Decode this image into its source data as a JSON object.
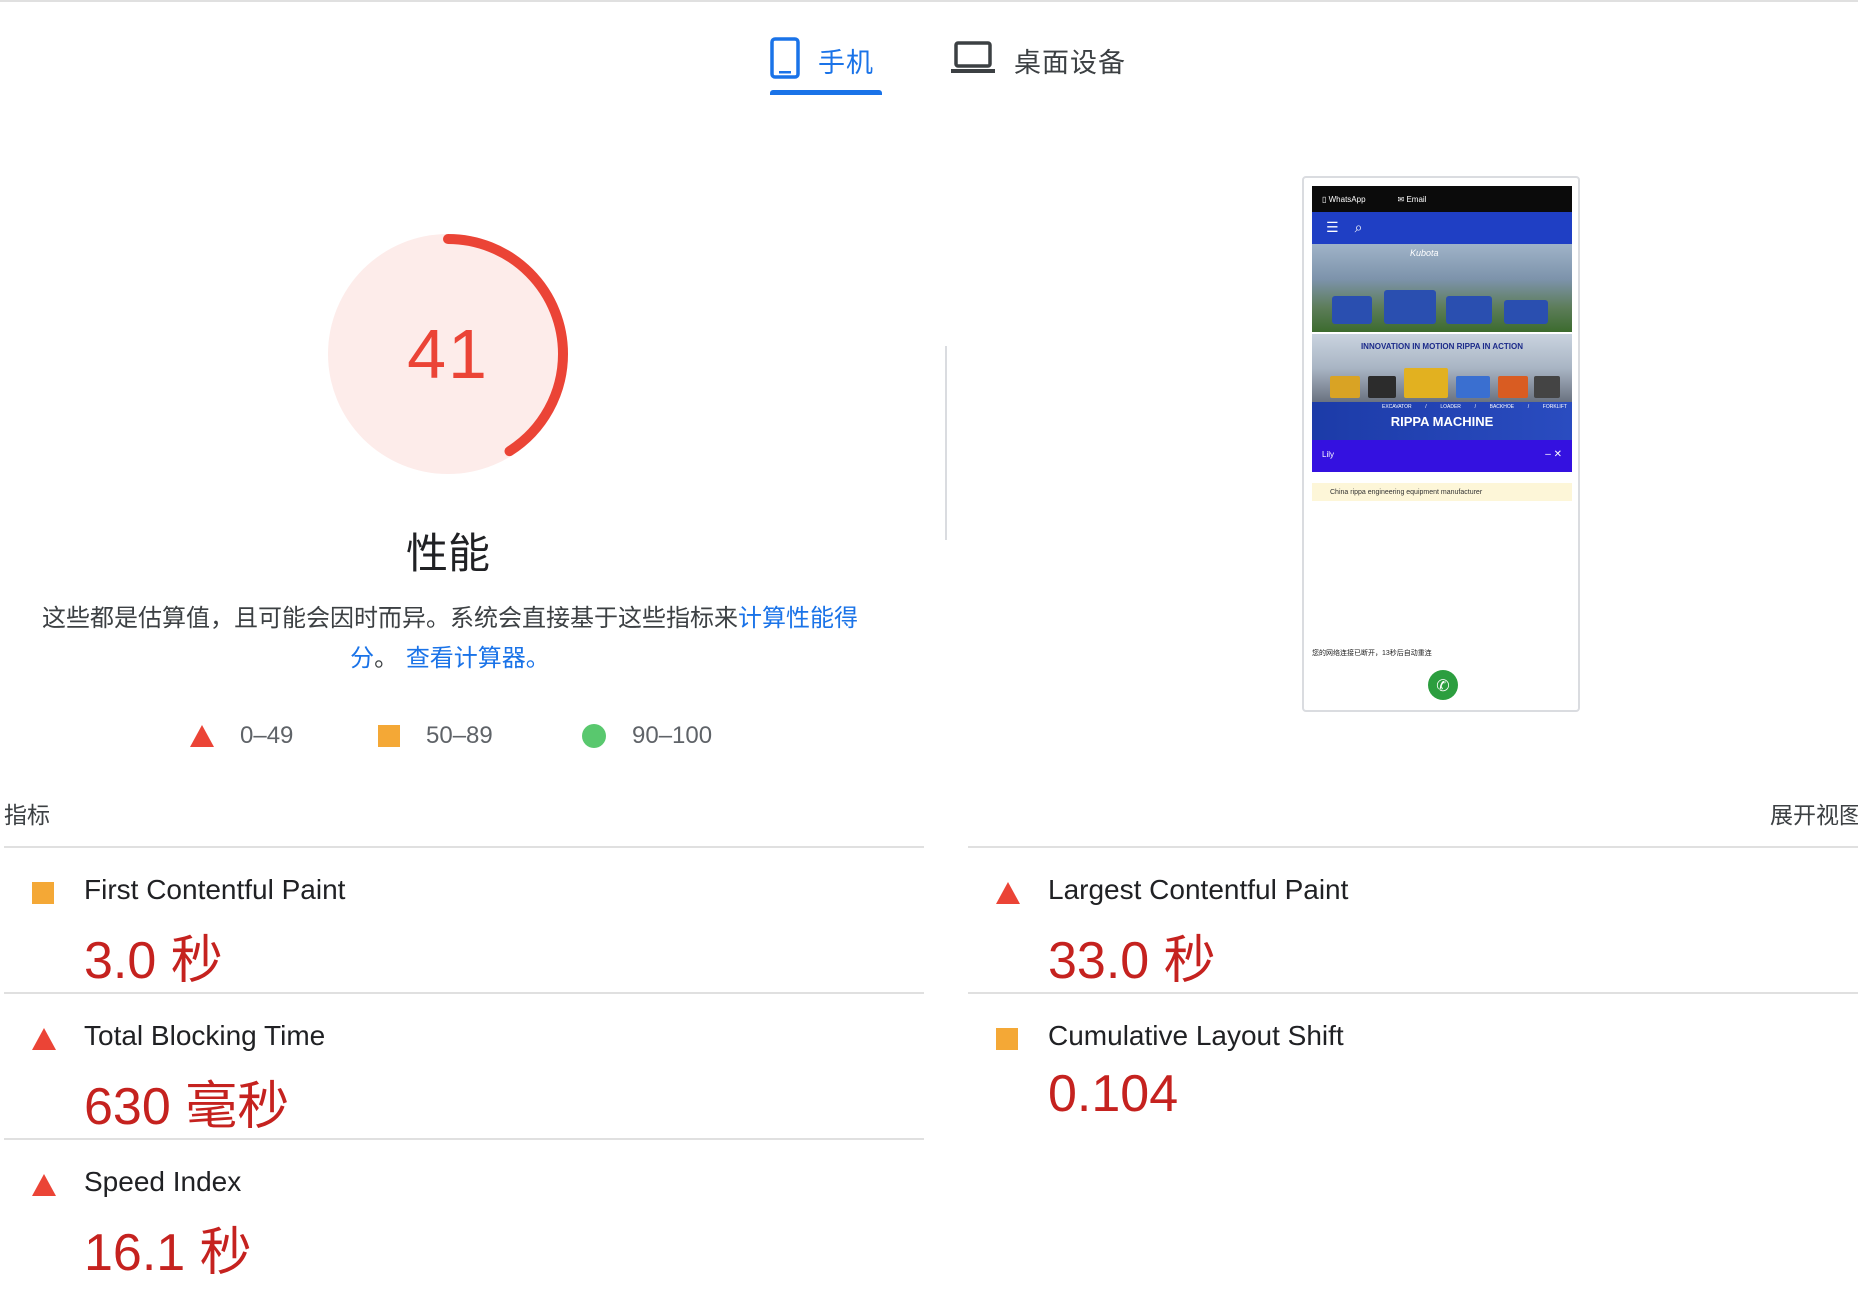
{
  "tabs": [
    {
      "label": "手机",
      "icon": "smartphone-icon",
      "active": true
    },
    {
      "label": "桌面设备",
      "icon": "laptop-icon",
      "active": false
    }
  ],
  "score": {
    "value": "41",
    "fraction": 0.41,
    "color": "#eb4436",
    "bg": "#fdecea"
  },
  "category_title": "性能",
  "description": {
    "text": "这些都是估算值，且可能会因时而异。系统会直接基于这些指标来",
    "link1": "计算性能得分",
    "sep": "。",
    "link2": "查看计算器。"
  },
  "legend": [
    {
      "range": "0–49",
      "shape": "triangle",
      "color": "#eb4436"
    },
    {
      "range": "50–89",
      "shape": "square",
      "color": "#f4a836"
    },
    {
      "range": "90–100",
      "shape": "circle",
      "color": "#59c86e"
    }
  ],
  "screenshot": {
    "topbar": [
      "WhatsApp",
      "Email"
    ],
    "nav_icons": [
      "menu-icon",
      "search-icon"
    ],
    "brand": "Kubota",
    "tagline": "INNOVATION IN MOTION  RIPPA IN ACTION",
    "categories": [
      "EXCAVATOR",
      "/",
      "LOADER",
      "/",
      "BACKHOE",
      "/",
      "FORKLIFT"
    ],
    "title": "RIPPA MACHINE",
    "chat_name": "Lily",
    "chat_controls": "– ✕",
    "notice": "China rippa engineering equipment manufacturer",
    "disconnected": "您的网络连接已断开，13秒后自动重连"
  },
  "metrics_header": "指标",
  "expand_view": "展开视图",
  "metrics": [
    {
      "title": "First Contentful Paint",
      "value": "3.0 秒",
      "rating": "average"
    },
    {
      "title": "Largest Contentful Paint",
      "value": "33.0 秒",
      "rating": "fail"
    },
    {
      "title": "Total Blocking Time",
      "value": "630 毫秒",
      "rating": "fail"
    },
    {
      "title": "Cumulative Layout Shift",
      "value": "0.104",
      "rating": "average"
    },
    {
      "title": "Speed Index",
      "value": "16.1 秒",
      "rating": "fail"
    }
  ]
}
